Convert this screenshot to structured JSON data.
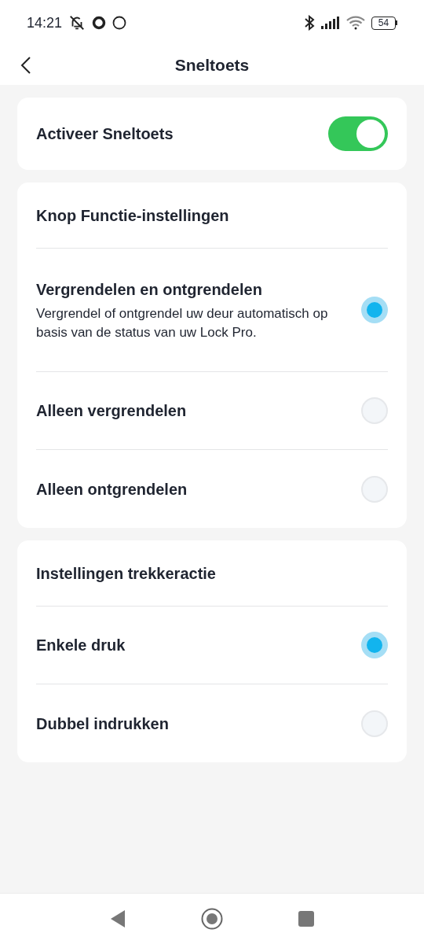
{
  "status_bar": {
    "time": "14:21",
    "battery": "54"
  },
  "header": {
    "title": "Sneltoets"
  },
  "activate": {
    "label": "Activeer Sneltoets",
    "on": true
  },
  "sections": [
    {
      "title": "Knop Functie-instellingen",
      "options": [
        {
          "label": "Vergrendelen en ontgrendelen",
          "description": "Vergrendel of ontgrendel uw deur automatisch op basis van de status van uw Lock Pro.",
          "selected": true
        },
        {
          "label": "Alleen vergrendelen",
          "selected": false
        },
        {
          "label": "Alleen ontgrendelen",
          "selected": false
        }
      ]
    },
    {
      "title": "Instellingen trekkeractie",
      "options": [
        {
          "label": "Enkele druk",
          "selected": true
        },
        {
          "label": "Dubbel indrukken",
          "selected": false
        }
      ]
    }
  ]
}
